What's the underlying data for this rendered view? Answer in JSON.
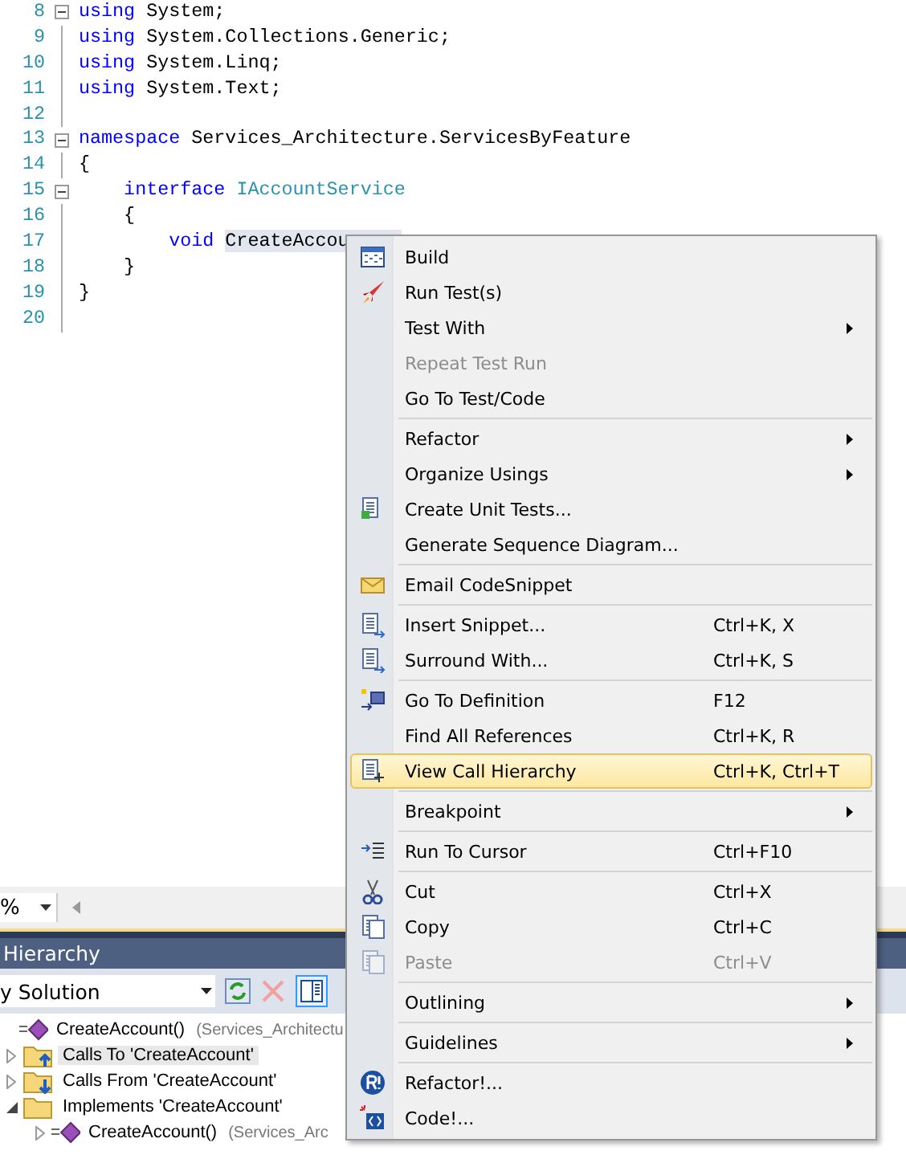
{
  "editor": {
    "lines": [
      {
        "number": "8",
        "fold": true,
        "tokens": [
          {
            "text": "using",
            "kind": "keyword"
          },
          {
            "text": " System;",
            "kind": "plain"
          }
        ]
      },
      {
        "number": "9",
        "fold": false,
        "tokens": [
          {
            "text": "using",
            "kind": "keyword"
          },
          {
            "text": " System.Collections.Generic;",
            "kind": "plain"
          }
        ]
      },
      {
        "number": "10",
        "fold": false,
        "tokens": [
          {
            "text": "using",
            "kind": "keyword"
          },
          {
            "text": " System.Linq;",
            "kind": "plain"
          }
        ]
      },
      {
        "number": "11",
        "fold": false,
        "tokens": [
          {
            "text": "using",
            "kind": "keyword"
          },
          {
            "text": " System.Text;",
            "kind": "plain"
          }
        ]
      },
      {
        "number": "12",
        "fold": false
      },
      {
        "number": "13",
        "fold": true,
        "tokens": [
          {
            "text": "namespace",
            "kind": "keyword"
          },
          {
            "text": " Services_Architecture.ServicesByFeature",
            "kind": "plain"
          }
        ]
      },
      {
        "number": "14",
        "fold": false,
        "tokens": [
          {
            "text": "{",
            "kind": "plain"
          }
        ]
      },
      {
        "number": "15",
        "fold": true,
        "tokens": [
          {
            "text": "    interface",
            "kind": "keyword"
          },
          {
            "text": "IAccountService",
            "kind": "type"
          }
        ]
      },
      {
        "number": "16",
        "fold": false,
        "tokens": [
          {
            "text": "    {",
            "kind": "plain"
          }
        ]
      },
      {
        "number": "17",
        "fold": false,
        "tokens": [
          {
            "text": "        void",
            "kind": "keyword"
          },
          {
            "text": "CreateAccou",
            "kind": "highlight"
          }
        ]
      },
      {
        "number": "18",
        "fold": false,
        "tokens": [
          {
            "text": "    }",
            "kind": "plain"
          }
        ]
      },
      {
        "number": "19",
        "fold": false,
        "tokens": [
          {
            "text": "}",
            "kind": "plain"
          }
        ]
      },
      {
        "number": "20",
        "fold": false
      }
    ]
  },
  "zoom": {
    "value": "%"
  },
  "hierarchy": {
    "title": "Hierarchy",
    "scope": "y Solution",
    "tree": [
      {
        "kind": "method",
        "label": "CreateAccount()",
        "detail": "(Services_Architectu",
        "children": [
          {
            "kind": "folder-up",
            "label": "Calls To 'CreateAccount'",
            "expanded": false,
            "selected": true
          },
          {
            "kind": "folder-down",
            "label": "Calls From 'CreateAccount'",
            "expanded": false,
            "selected": false
          },
          {
            "kind": "folder",
            "label": "Implements 'CreateAccount'",
            "expanded": true,
            "selected": false,
            "children": [
              {
                "kind": "method",
                "label": "CreateAccount()",
                "detail": "(Services_Arc",
                "expanded": false,
                "selected": false
              }
            ]
          }
        ]
      }
    ]
  },
  "context_menu": {
    "items": [
      {
        "kind": "item",
        "label": "Build",
        "disabled": false,
        "selected": false
      },
      {
        "kind": "item",
        "label": "Run Test(s)",
        "disabled": false,
        "selected": false
      },
      {
        "kind": "item",
        "label": "Test With",
        "submenu": true,
        "disabled": false,
        "selected": false
      },
      {
        "kind": "item",
        "label": "Repeat Test Run",
        "disabled": true,
        "selected": false
      },
      {
        "kind": "item",
        "label": "Go To Test/Code",
        "disabled": false,
        "selected": false
      },
      {
        "kind": "separator"
      },
      {
        "kind": "item",
        "label": "Refactor",
        "submenu": true,
        "disabled": false,
        "selected": false
      },
      {
        "kind": "item",
        "label": "Organize Usings",
        "submenu": true,
        "disabled": false,
        "selected": false
      },
      {
        "kind": "item",
        "label": "Create Unit Tests...",
        "disabled": false,
        "selected": false
      },
      {
        "kind": "item",
        "label": "Generate Sequence Diagram...",
        "disabled": false,
        "selected": false
      },
      {
        "kind": "separator"
      },
      {
        "kind": "item",
        "label": "Email CodeSnippet",
        "disabled": false,
        "selected": false
      },
      {
        "kind": "separator"
      },
      {
        "kind": "item",
        "label": "Insert Snippet...",
        "shortcut": "Ctrl+K, X",
        "disabled": false,
        "selected": false
      },
      {
        "kind": "item",
        "label": "Surround With...",
        "shortcut": "Ctrl+K, S",
        "disabled": false,
        "selected": false
      },
      {
        "kind": "separator"
      },
      {
        "kind": "item",
        "label": "Go To Definition",
        "shortcut": "F12",
        "disabled": false,
        "selected": false
      },
      {
        "kind": "item",
        "label": "Find All References",
        "shortcut": "Ctrl+K, R",
        "disabled": false,
        "selected": false
      },
      {
        "kind": "item",
        "label": "View Call Hierarchy",
        "shortcut": "Ctrl+K, Ctrl+T",
        "disabled": false,
        "selected": true
      },
      {
        "kind": "separator"
      },
      {
        "kind": "item",
        "label": "Breakpoint",
        "submenu": true,
        "disabled": false,
        "selected": false
      },
      {
        "kind": "separator"
      },
      {
        "kind": "item",
        "label": "Run To Cursor",
        "shortcut": "Ctrl+F10",
        "disabled": false,
        "selected": false
      },
      {
        "kind": "separator"
      },
      {
        "kind": "item",
        "label": "Cut",
        "shortcut": "Ctrl+X",
        "disabled": false,
        "selected": false
      },
      {
        "kind": "item",
        "label": "Copy",
        "shortcut": "Ctrl+C",
        "disabled": false,
        "selected": false
      },
      {
        "kind": "item",
        "label": "Paste",
        "shortcut": "Ctrl+V",
        "disabled": true,
        "selected": false
      },
      {
        "kind": "separator"
      },
      {
        "kind": "item",
        "label": "Outlining",
        "submenu": true,
        "disabled": false,
        "selected": false
      },
      {
        "kind": "separator"
      },
      {
        "kind": "item",
        "label": "Guidelines",
        "submenu": true,
        "disabled": false,
        "selected": false
      },
      {
        "kind": "separator"
      },
      {
        "kind": "item",
        "label": "Refactor!...",
        "disabled": false,
        "selected": false
      },
      {
        "kind": "item",
        "label": "Code!...",
        "disabled": false,
        "selected": false
      }
    ]
  }
}
